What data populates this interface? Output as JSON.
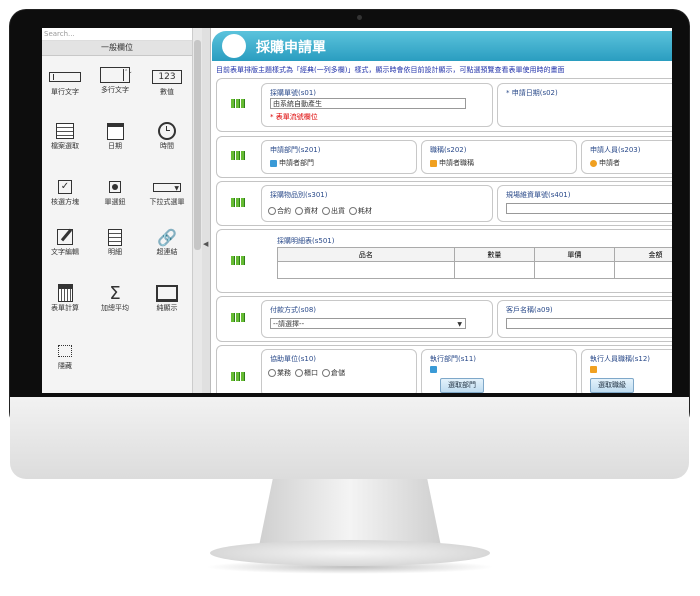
{
  "palette": {
    "search_placeholder": "Search...",
    "header": "一般欄位",
    "items": [
      {
        "label": "單行文字",
        "icon": "single-line-text-icon"
      },
      {
        "label": "多行文字",
        "icon": "multi-line-text-icon"
      },
      {
        "label": "數值",
        "icon": "number-icon",
        "glyph": "123"
      },
      {
        "label": "檔案選取",
        "icon": "file-select-icon"
      },
      {
        "label": "日期",
        "icon": "calendar-icon"
      },
      {
        "label": "時間",
        "icon": "clock-icon"
      },
      {
        "label": "核選方塊",
        "icon": "checkbox-icon"
      },
      {
        "label": "單選鈕",
        "icon": "radio-button-icon"
      },
      {
        "label": "下拉式選單",
        "icon": "dropdown-icon"
      },
      {
        "label": "文字編輯",
        "icon": "text-edit-icon"
      },
      {
        "label": "明細",
        "icon": "details-icon"
      },
      {
        "label": "超連結",
        "icon": "link-icon"
      },
      {
        "label": "表單計算",
        "icon": "calculator-icon"
      },
      {
        "label": "加總平均",
        "icon": "sum-icon",
        "glyph": "Σ"
      },
      {
        "label": "純顯示",
        "icon": "display-icon"
      },
      {
        "label": "隱藏",
        "icon": "hidden-icon"
      }
    ]
  },
  "form": {
    "title": "採購申請單",
    "notice": "目前表單排版主題樣式為「經典(一列多欄)」樣式，顯示時會依目前設計顯示，可點選預覽查看表單使用時的畫面",
    "row1": {
      "serial_label": "採購單號(s01)",
      "serial_value": "由系統自動產生",
      "serial_note": "* 表單流號欄位",
      "date_label": "* 申請日期(s02)"
    },
    "row2": {
      "dept_label": "申請部門(s201)",
      "dept_value": "申請者部門",
      "title_label": "職稱(s202)",
      "title_value": "申請者職稱",
      "person_label": "申請人員(s203)",
      "person_value": "申請者"
    },
    "row3": {
      "category_label": "採購物品別(s301)",
      "category_options": [
        "合約",
        "資材",
        "出貨",
        "耗材"
      ],
      "asset_label": "規場維資單號(s401)"
    },
    "row4": {
      "detail_label": "採購明細表(s501)",
      "columns": [
        "品名",
        "數量",
        "單價",
        "金額"
      ]
    },
    "row5": {
      "payment_label": "付款方式(s08)",
      "payment_value": "--請選擇--",
      "customer_label": "客戶名稱(a09)"
    },
    "row6": {
      "unit_label": "協助單位(s10)",
      "unit_options": [
        "業務",
        "櫃口",
        "倉儲"
      ],
      "exec_dept_label": "執行部門(s11)",
      "exec_dept_button": "選取部門",
      "exec_title_label": "執行人員職稱(s12)",
      "exec_title_button": "選取職級"
    }
  }
}
